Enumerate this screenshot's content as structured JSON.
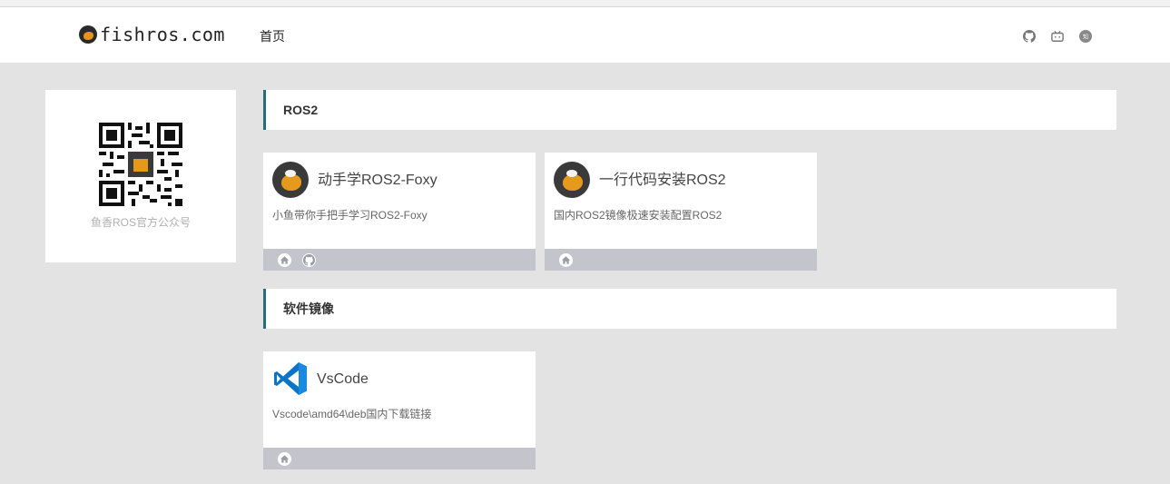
{
  "header": {
    "logo_text": "fishros.com",
    "nav": [
      {
        "label": "首页"
      }
    ],
    "icons": [
      "github-icon",
      "bilibili-icon",
      "zhihu-icon"
    ]
  },
  "sidebar": {
    "qr_caption": "鱼香ROS官方公众号"
  },
  "sections": [
    {
      "title": "ROS2",
      "cards": [
        {
          "title": "动手学ROS2-Foxy",
          "description": "小鱼带你手把手学习ROS2-Foxy",
          "links": [
            "home-icon",
            "github-icon"
          ]
        },
        {
          "title": "一行代码安装ROS2",
          "description": "国内ROS2镜像极速安装配置ROS2",
          "links": [
            "home-icon"
          ]
        }
      ]
    },
    {
      "title": "软件镜像",
      "cards": [
        {
          "title": "VsCode",
          "description": "Vscode\\amd64\\deb国内下载链接",
          "links": [
            "home-icon"
          ]
        }
      ]
    }
  ],
  "colors": {
    "accent": "#276e7a",
    "background": "#e3e3e3",
    "card_footer": "#c4c4cc",
    "vscode_blue": "#0078d4"
  }
}
